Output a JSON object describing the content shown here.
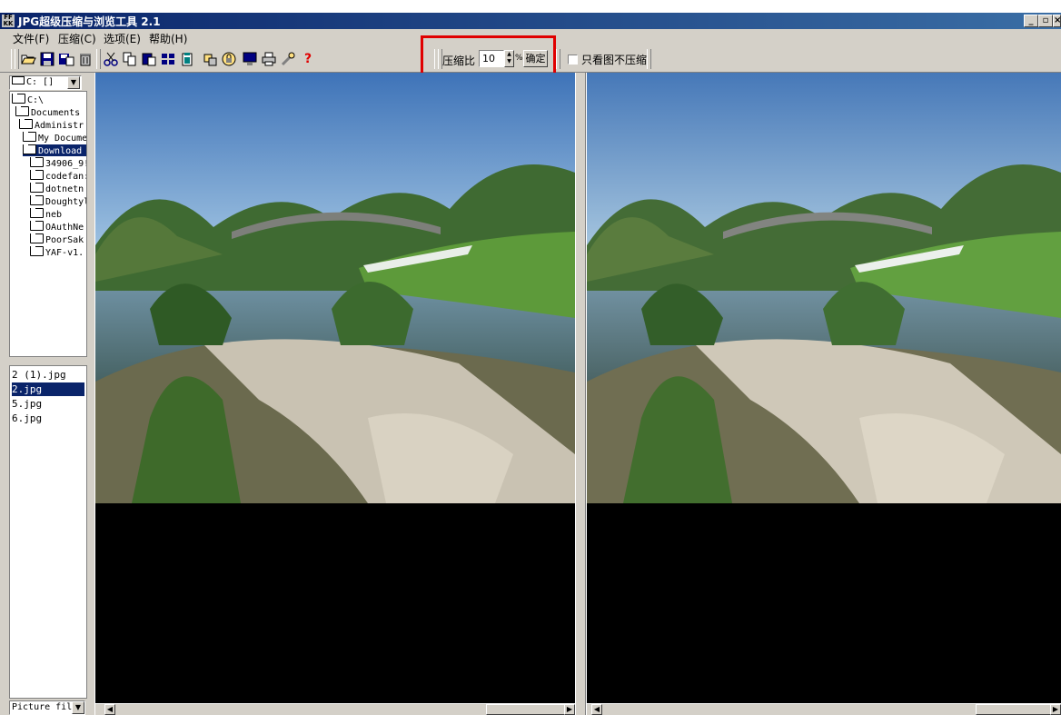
{
  "window": {
    "title": "JPG超级压缩与浏览工具 2.1",
    "icon_text": "FF KK"
  },
  "menu": [
    "文件(F)",
    "压缩(C)",
    "选项(E)",
    "帮助(H)"
  ],
  "toolbar_icons": [
    "open-folder-icon",
    "save-icon",
    "save-as-icon",
    "delete-icon",
    "cut-icon",
    "copy-icon",
    "paste-icon",
    "thumbnails-icon",
    "clipboard-icon",
    "rotate-icon",
    "lock-icon",
    "monitor-icon",
    "print-icon",
    "tools-icon",
    "help-icon"
  ],
  "compression": {
    "label": "压缩比",
    "value": "10",
    "unit": "%",
    "confirm_label": "确定"
  },
  "view_only": {
    "label": "只看图不压缩",
    "checked": false
  },
  "drive": {
    "label": "C: []"
  },
  "tree": [
    {
      "label": "C:\\",
      "selected": false
    },
    {
      "label": "Documents",
      "selected": false
    },
    {
      "label": "Administr",
      "selected": false
    },
    {
      "label": "My Docume",
      "selected": false
    },
    {
      "label": "Download",
      "selected": true
    },
    {
      "label": "34906_9!",
      "selected": false
    },
    {
      "label": "codefan:",
      "selected": false
    },
    {
      "label": "dotnetn",
      "selected": false
    },
    {
      "label": "Doughtyl",
      "selected": false
    },
    {
      "label": "neb",
      "selected": false
    },
    {
      "label": "OAuthNe",
      "selected": false
    },
    {
      "label": "PoorSak",
      "selected": false
    },
    {
      "label": "YAF-v1.",
      "selected": false
    }
  ],
  "files": [
    {
      "name": "2 (1).jpg",
      "selected": false
    },
    {
      "name": "2.jpg",
      "selected": true
    },
    {
      "name": "5.jpg",
      "selected": false
    },
    {
      "name": "6.jpg",
      "selected": false
    }
  ],
  "filter": {
    "label": "Picture fil"
  },
  "panes": {
    "left_name": "original-image",
    "right_name": "compressed-image"
  }
}
